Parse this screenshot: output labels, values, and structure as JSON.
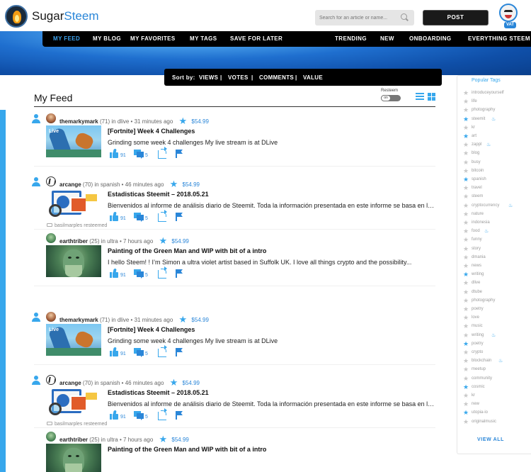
{
  "app": {
    "brand_part1": "Sugar",
    "brand_part2": "Steem"
  },
  "search": {
    "placeholder": "Search for an article or name..."
  },
  "header": {
    "post_label": "POST",
    "avatar_badge": "VAT"
  },
  "nav": {
    "items": [
      {
        "label": "MY FEED",
        "active": true
      },
      {
        "label": "MY BLOG",
        "active": false
      },
      {
        "label": "MY FAVORITES",
        "active": false
      },
      {
        "label": "MY TAGS",
        "active": false
      },
      {
        "label": "SAVE FOR LATER",
        "active": false
      },
      {
        "label": "TRENDING",
        "active": false
      },
      {
        "label": "NEW",
        "active": false
      },
      {
        "label": "ONBOARDING",
        "active": false
      },
      {
        "label": "EVERYTHING STEEM",
        "active": false
      }
    ]
  },
  "sort": {
    "label": "Sort by:",
    "options": [
      "VIEWS",
      "VOTES",
      "COMMENTS",
      "VALUE"
    ],
    "separator": "|"
  },
  "feed": {
    "title": "My Feed",
    "resteem_label": "Resteem",
    "toggle_value": "on",
    "posts": [
      {
        "resteemed_by": "",
        "author": "themarkymark",
        "rep": "(71)",
        "category": "in dlive",
        "time": "31 minutes ago",
        "payout": "$54.99",
        "title": "[Fortnite] Week 4 Challenges",
        "excerpt": "Grinding some week 4 challenges My live stream is at DLive",
        "votes": "91",
        "comments": "5",
        "thumb": "fortnite",
        "thumb_label": "Live"
      },
      {
        "resteemed_by": "",
        "author": "arcange",
        "rep": "(70)",
        "category": "in spanish",
        "time": "46 minutes ago",
        "payout": "$54.99",
        "title": "Estadisticas Steemit – 2018.05.21",
        "excerpt": "Bienvenidos al informe de análisis diario de Steemit. Toda la información presentada en este informe se basa en los datos...",
        "votes": "91",
        "comments": "5",
        "thumb": "stats",
        "thumb_label": ""
      },
      {
        "resteemed_by": "basilmarples resteemed",
        "author": "earthtriber",
        "rep": "(25)",
        "category": "in ultra",
        "time": "7 hours ago",
        "payout": "$54.99",
        "title": "Painting of the Green Man and WIP with bit of a intro",
        "excerpt": "I hello Steem! ! I’m Simon a ultra violet artist based in Suffolk UK. I love all things crypto and the possibility...",
        "votes": "91",
        "comments": "5",
        "thumb": "greenman",
        "thumb_label": ""
      },
      {
        "resteemed_by": "",
        "author": "themarkymark",
        "rep": "(71)",
        "category": "in dlive",
        "time": "31 minutes ago",
        "payout": "$54.99",
        "title": "[Fortnite] Week 4 Challenges",
        "excerpt": "Grinding some week 4 challenges My live stream is at DLive",
        "votes": "91",
        "comments": "5",
        "thumb": "fortnite",
        "thumb_label": "Live"
      },
      {
        "resteemed_by": "",
        "author": "arcange",
        "rep": "(70)",
        "category": "in spanish",
        "time": "46 minutes ago",
        "payout": "$54.99",
        "title": "Estadisticas Steemit – 2018.05.21",
        "excerpt": "Bienvenidos al informe de análisis diario de Steemit. Toda la información presentada en este informe se basa en los datos...",
        "votes": "91",
        "comments": "5",
        "thumb": "stats",
        "thumb_label": ""
      },
      {
        "resteemed_by": "basilmarples resteemed",
        "author": "earthtriber",
        "rep": "(25)",
        "category": "in ultra",
        "time": "7 hours ago",
        "payout": "$54.99",
        "title": "Painting of the Green Man and WIP with bit of a intro",
        "excerpt": "",
        "votes": "",
        "comments": "",
        "thumb": "greenman",
        "thumb_label": ""
      }
    ]
  },
  "sidebar": {
    "title": "Popular Tags",
    "view_all": "VIEW ALL",
    "tags": [
      {
        "name": "introduceyourself",
        "fav": false,
        "hot": false
      },
      {
        "name": "life",
        "fav": false,
        "hot": false
      },
      {
        "name": "photography",
        "fav": false,
        "hot": false
      },
      {
        "name": "steemit",
        "fav": true,
        "hot": true
      },
      {
        "name": "kr",
        "fav": false,
        "hot": false
      },
      {
        "name": "art",
        "fav": true,
        "hot": false
      },
      {
        "name": "zappl",
        "fav": false,
        "hot": true
      },
      {
        "name": "blog",
        "fav": false,
        "hot": false
      },
      {
        "name": "busy",
        "fav": false,
        "hot": false
      },
      {
        "name": "bitcoin",
        "fav": false,
        "hot": false
      },
      {
        "name": "spanish",
        "fav": true,
        "hot": false
      },
      {
        "name": "travel",
        "fav": false,
        "hot": false
      },
      {
        "name": "steem",
        "fav": false,
        "hot": false
      },
      {
        "name": "cryptocurrency",
        "fav": false,
        "hot": true
      },
      {
        "name": "nature",
        "fav": false,
        "hot": false
      },
      {
        "name": "indonesia",
        "fav": false,
        "hot": false
      },
      {
        "name": "food",
        "fav": false,
        "hot": true
      },
      {
        "name": "funny",
        "fav": false,
        "hot": false
      },
      {
        "name": "story",
        "fav": false,
        "hot": false
      },
      {
        "name": "dmania",
        "fav": false,
        "hot": false
      },
      {
        "name": "news",
        "fav": false,
        "hot": false
      },
      {
        "name": "writing",
        "fav": true,
        "hot": false
      },
      {
        "name": "dlive",
        "fav": false,
        "hot": false
      },
      {
        "name": "dtube",
        "fav": false,
        "hot": false
      },
      {
        "name": "photography",
        "fav": false,
        "hot": false
      },
      {
        "name": "poetry",
        "fav": false,
        "hot": false
      },
      {
        "name": "love",
        "fav": false,
        "hot": false
      },
      {
        "name": "music",
        "fav": false,
        "hot": false
      },
      {
        "name": "writing",
        "fav": false,
        "hot": true
      },
      {
        "name": "poetry",
        "fav": true,
        "hot": false
      },
      {
        "name": "crypto",
        "fav": false,
        "hot": false
      },
      {
        "name": "blockchain",
        "fav": false,
        "hot": true
      },
      {
        "name": "meetup",
        "fav": false,
        "hot": false
      },
      {
        "name": "community",
        "fav": false,
        "hot": false
      },
      {
        "name": "cosmic",
        "fav": true,
        "hot": false
      },
      {
        "name": "kr",
        "fav": false,
        "hot": false
      },
      {
        "name": "new",
        "fav": false,
        "hot": false
      },
      {
        "name": "utopia-io",
        "fav": true,
        "hot": false
      },
      {
        "name": "originalmusic",
        "fav": false,
        "hot": false
      }
    ]
  },
  "colors": {
    "accent": "#37a7ec",
    "link": "#2a86d8",
    "nav_bg": "#000000",
    "banner": "#1f6fcf"
  },
  "icons": {
    "user": "user-icon",
    "star": "star-icon",
    "thumbs_up": "thumbs-up-icon",
    "comment": "comment-icon",
    "share": "share-icon",
    "flag": "flag-icon",
    "resteem": "resteem-icon",
    "search": "search-icon",
    "list_view": "list-view-icon",
    "grid_view": "grid-view-icon",
    "fire": "fire-icon"
  }
}
